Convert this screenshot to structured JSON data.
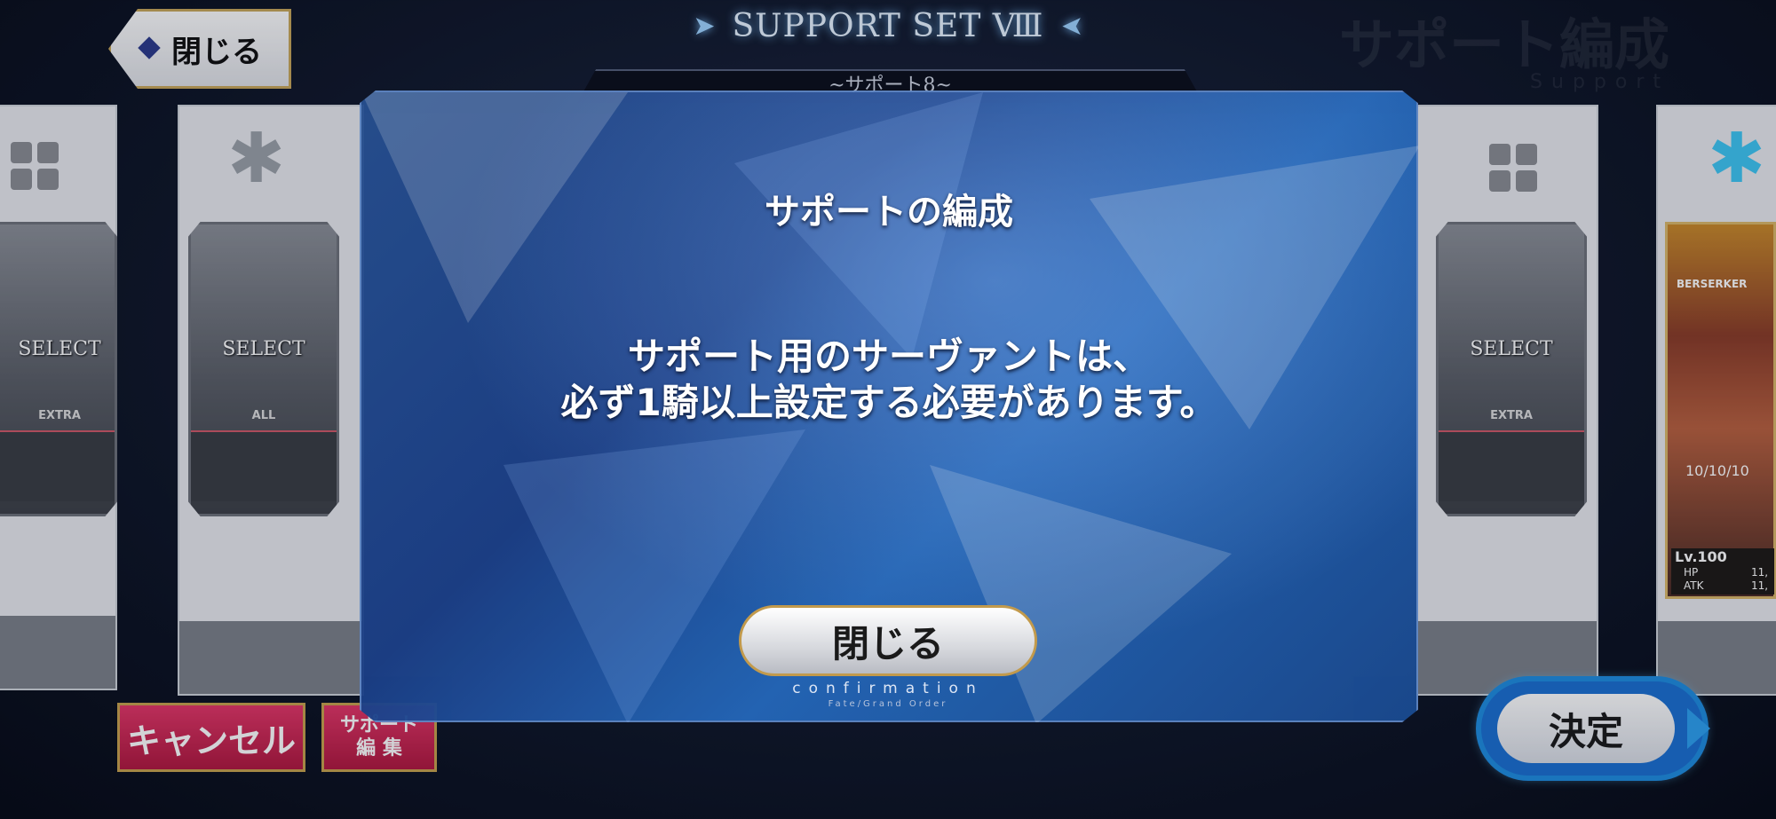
{
  "header": {
    "back_label": "閉じる",
    "set_title": "SUPPORT SET Ⅷ",
    "watermark": "サポート編成",
    "watermark_sub": "Support",
    "sub_tab": "~サポート8~"
  },
  "panels": {
    "left_partial": {
      "slot_label": "SELECT",
      "slot_sub": "EXTRA"
    },
    "left": {
      "slot_label": "SELECT",
      "slot_sub": "ALL"
    },
    "right": {
      "slot_label": "SELECT",
      "slot_sub": "EXTRA"
    }
  },
  "servant_card": {
    "class": "BERSERKER",
    "fou": "10/10/10",
    "level": "Lv.100",
    "hp_label": "HP",
    "atk_label": "ATK",
    "hp_value": "11,",
    "atk_value": "11,"
  },
  "dialog": {
    "title": "サポートの編成",
    "message_line1": "サポート用のサーヴァントは、",
    "message_line2": "必ず1騎以上設定する必要があります。",
    "close_label": "閉じる",
    "confirm_text": "confirmation",
    "confirm_sub": "Fate/Grand Order"
  },
  "footer": {
    "cancel_label": "キャンセル",
    "edit_line1": "サポート",
    "edit_line2": "編 集",
    "decide_label": "決定"
  },
  "colors": {
    "accent_blue": "#1b6fd1",
    "cancel_red": "#d12a57",
    "gold_border": "#c7a24e"
  }
}
